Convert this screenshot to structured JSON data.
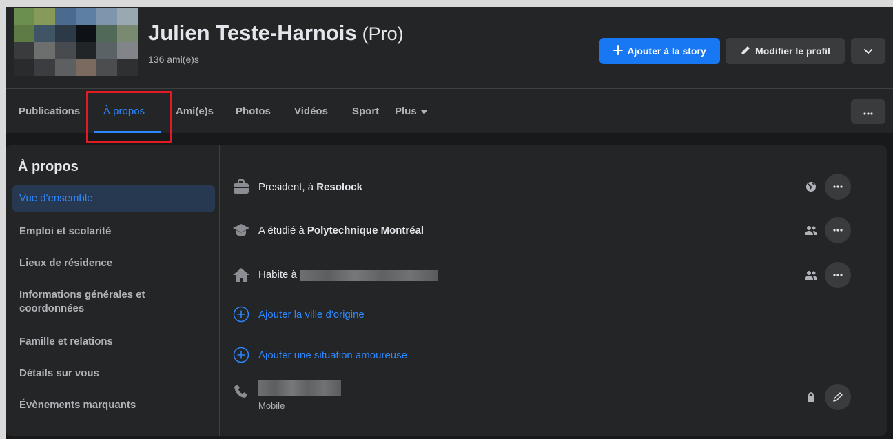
{
  "profile": {
    "name": "Julien Teste-Harnois",
    "suffix": "(Pro)",
    "friends_count": "136 ami(e)s"
  },
  "header_buttons": {
    "add_story": "Ajouter à la story",
    "edit_profile": "Modifier le profil"
  },
  "tabs": [
    {
      "label": "Publications"
    },
    {
      "label": "À propos"
    },
    {
      "label": "Ami(e)s"
    },
    {
      "label": "Photos"
    },
    {
      "label": "Vidéos"
    },
    {
      "label": "Sport"
    },
    {
      "label": "Plus"
    }
  ],
  "about": {
    "title": "À propos",
    "nav": [
      {
        "label": "Vue d'ensemble"
      },
      {
        "label": "Emploi et scolarité"
      },
      {
        "label": "Lieux de résidence"
      },
      {
        "label": "Informations générales et coordonnées"
      },
      {
        "label": "Famille et relations"
      },
      {
        "label": "Détails sur vous"
      },
      {
        "label": "Évènements marquants"
      }
    ],
    "overview": {
      "work_prefix": "President, à ",
      "work_place": "Resolock",
      "study_prefix": "A étudié à ",
      "study_place": "Polytechnique Montréal",
      "lives_prefix": "Habite à ",
      "add_hometown": "Ajouter la ville d'origine",
      "add_relationship": "Ajouter une situation amoureuse",
      "phone_label": "Mobile"
    }
  },
  "icons": {
    "add_story": "plus-icon",
    "edit_profile": "pencil-icon",
    "more": "chevron-down-icon",
    "tab_more": "ellipsis-icon",
    "work": "briefcase-icon",
    "study": "graduation-cap-icon",
    "lives": "house-icon",
    "add": "plus-circle-icon",
    "phone": "phone-icon",
    "public": "globe-icon",
    "friends": "friends-icon",
    "private": "lock-icon"
  },
  "colors": {
    "accent": "#2d88ff",
    "primary_button": "#1877f2",
    "highlight_box": "#e01b24",
    "background": "#18191a",
    "surface": "#242526"
  }
}
